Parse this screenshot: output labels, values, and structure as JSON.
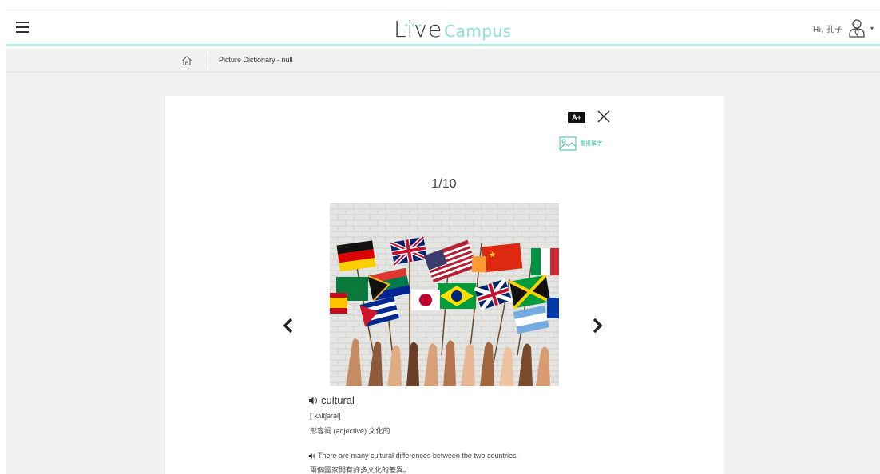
{
  "header": {
    "logo_live": "Live",
    "logo_campus": "Campus",
    "greeting": "Hi, 孔子",
    "menu_icon": "hamburger-icon",
    "user_icon": "user-icon",
    "caret": "▾"
  },
  "breadcrumb": {
    "home_icon": "home-icon",
    "title": "Picture Dictionary - null"
  },
  "toolbar": {
    "font_size_label": "A+",
    "close_icon": "close-icon",
    "review_icon": "image-icon",
    "review_label": "重複單字"
  },
  "viewer": {
    "counter": "1/10",
    "prev_icon": "chevron-left-icon",
    "next_icon": "chevron-right-icon",
    "image_alt": "hands holding international flags"
  },
  "entry": {
    "word": "cultural",
    "phonetic": "[ˈkʌltʃərəl]",
    "part_of_speech": "形容詞 (adjective) 文化的",
    "example": "There are many cultural differences between the two countries.",
    "example_translation": "兩個國家間有許多文化的差異。"
  },
  "colors": {
    "accent": "#8de2cf",
    "accent_text": "#3bbfa0",
    "background": "#f1f1f1",
    "header_border": "#b8ece0"
  }
}
